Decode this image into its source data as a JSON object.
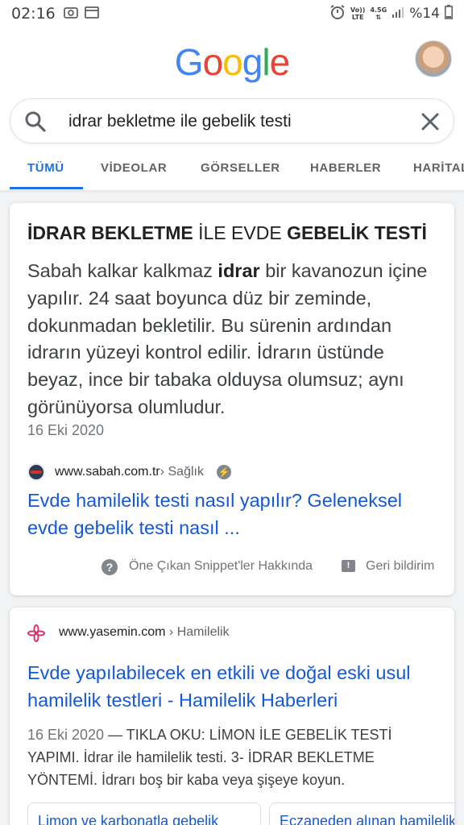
{
  "status_bar": {
    "time": "02:16",
    "volte": "Vo))",
    "lte": "LTE",
    "network": "4.5G",
    "battery": "%14"
  },
  "header": {
    "logo": [
      "G",
      "o",
      "o",
      "g",
      "l",
      "e"
    ],
    "logo_colors": [
      "#4285f4",
      "#ea4335",
      "#fbbc05",
      "#4285f4",
      "#34a853",
      "#ea4335"
    ]
  },
  "search": {
    "query": "idrar bekletme ile gebelik testi"
  },
  "tabs": [
    "TÜMÜ",
    "VİDEOLAR",
    "GÖRSELLER",
    "HABERLER",
    "HARİTALAR"
  ],
  "featured_snippet": {
    "title_parts": [
      "İDRAR BEKLETME",
      " İLE EVDE ",
      "GEBELİK TESTİ"
    ],
    "body_parts": [
      "Sabah kalkar kalkmaz ",
      "idrar",
      " bir kavanozun içine yapılır. 24 saat boyunca düz bir zeminde, dokunmadan bekletilir. Bu sürenin ardından idrarın yüzeyi kontrol edilir. İdrarın üstünde beyaz, ince bir tabaka olduysa olumsuz; aynı görünüyorsa olumludur."
    ],
    "date": "16 Eki 2020",
    "site": "www.sabah.com.tr",
    "breadcrumb": " › Sağlık",
    "link": "Evde hamilelik testi nasıl yapılır? Geleneksel evde gebelik testi nasıl ...",
    "about": "Öne Çıkan Snippet'ler Hakkında",
    "feedback": "Geri bildirim"
  },
  "result2": {
    "site": "www.yasemin.com",
    "breadcrumb": " › Hamilelik",
    "title": "Evde yapılabilecek en etkili ve doğal eski usul hamilelik testleri - Hamilelik Haberleri",
    "date": "16 Eki 2020",
    "snippet": " — TIKLA OKU: LİMON İLE GEBELİK TESTİ YAPIMI. İdrar ile hamilelik testi. 3- İDRAR BEKLETME YÖNTEMİ. İdrarı boş bir kaba veya şişeye koyun.",
    "sublinks": [
      "Limon ve karbonatla gebelik",
      "Eczaneden alınan hamilelik"
    ]
  },
  "colors": {
    "accent": "#1a73e8",
    "link": "#1558d6"
  }
}
